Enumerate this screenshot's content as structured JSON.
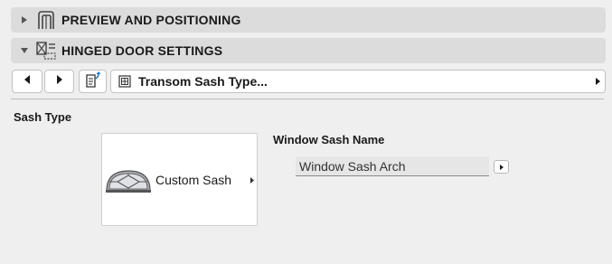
{
  "sections": {
    "preview": {
      "title": "PREVIEW AND POSITIONING",
      "collapsed": true,
      "icon": "door-frame-icon"
    },
    "hinged": {
      "title": "HINGED DOOR SETTINGS",
      "collapsed": false,
      "icon": "door-settings-icon"
    }
  },
  "toolbar": {
    "prev_icon": "triangle-left-icon",
    "next_icon": "triangle-right-icon",
    "page_icon": "page-select-icon",
    "current_page": {
      "icon": "sash-grid-icon",
      "label": "Transom Sash Type..."
    }
  },
  "sash_type": {
    "heading": "Sash Type",
    "selected_label": "Custom Sash",
    "preview_icon": "arch-window-icon"
  },
  "window_sash": {
    "heading": "Window Sash Name",
    "value": "Window Sash Arch"
  }
}
